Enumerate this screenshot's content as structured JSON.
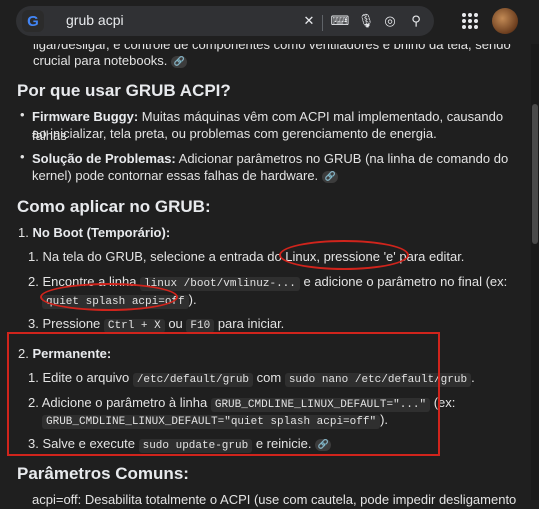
{
  "search": {
    "query": "grub acpi"
  },
  "intro_tail": {
    "line1": "ligar/desligar, e controle de componentes como ventiladores e brilho da tela, sendo",
    "line2": "crucial para notebooks."
  },
  "section_why": {
    "title": "Por que usar GRUB ACPI?",
    "items": [
      {
        "bold": "Firmware Buggy:",
        "text1": " Muitas máquinas vêm com ACPI mal implementado, causando falhas",
        "text2": "ao inicializar, tela preta, ou problemas com gerenciamento de energia."
      },
      {
        "bold": "Solução de Problemas:",
        "text1": " Adicionar parâmetros no GRUB (na linha de comando do",
        "text2": "kernel) pode contornar essas falhas de hardware."
      }
    ]
  },
  "section_how": {
    "title": "Como aplicar no GRUB:",
    "step1": {
      "num": "1.",
      "title": "No Boot (Temporário):",
      "sub1": {
        "num": "1.",
        "text_a": "Na tela do GRUB, selecione a entrada do Linux, ",
        "text_b": "pressione 'e' para editar."
      },
      "sub2": {
        "num": "2.",
        "text_a": "Encontre a linha ",
        "code1": "linux /boot/vmlinuz-...",
        "text_b": " e adicione o parâmetro no final (ex:",
        "code2": "quiet splash acpi=off",
        "text_c": ")."
      },
      "sub3": {
        "num": "3.",
        "text_a": "Pressione ",
        "code1": "Ctrl + X",
        "text_b": " ou ",
        "code2": "F10",
        "text_c": " para iniciar."
      }
    },
    "step2": {
      "num": "2.",
      "title": "Permanente:",
      "sub1": {
        "num": "1.",
        "text_a": "Edite o arquivo ",
        "code1": "/etc/default/grub",
        "text_b": " com ",
        "code2": "sudo nano /etc/default/grub",
        "text_c": "."
      },
      "sub2": {
        "num": "2.",
        "text_a": "Adicione o parâmetro à linha ",
        "code1": "GRUB_CMDLINE_LINUX_DEFAULT=\"...\"",
        "text_b": " (ex:",
        "code2": "GRUB_CMDLINE_LINUX_DEFAULT=\"quiet splash acpi=off\"",
        "text_c": ")."
      },
      "sub3": {
        "num": "3.",
        "text_a": "Salve e execute ",
        "code1": "sudo update-grub",
        "text_b": " e reinicie."
      }
    }
  },
  "section_params": {
    "title": "Parâmetros Comuns:",
    "cut_line": "acpi=off: Desabilita totalmente o ACPI (use com cautela, pode impedir desligamento"
  },
  "link_chip_glyph": "🔗",
  "colors": {
    "annotation": "#d0241c",
    "background": "#1f1f1f"
  }
}
